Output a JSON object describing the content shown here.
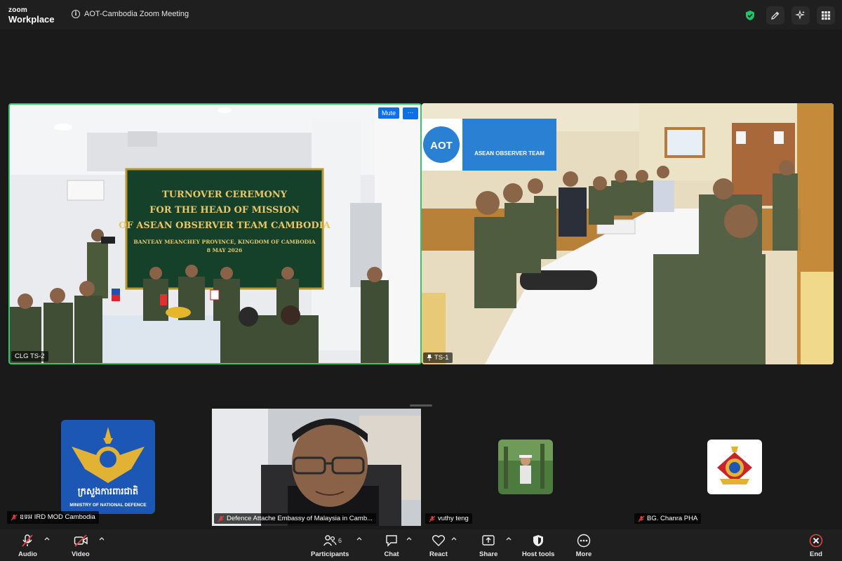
{
  "app": {
    "brand_top": "zoom",
    "brand_bottom": "Workplace",
    "meeting_title": "AOT-Cambodia Zoom Meeting",
    "accent": "#0e6fe8",
    "active_speaker_border": "#35c46b"
  },
  "top_actions": [
    {
      "icon": "shield-check-icon"
    },
    {
      "icon": "pencil-icon"
    },
    {
      "icon": "sparkle-icon"
    },
    {
      "icon": "grid-icon"
    }
  ],
  "videos": {
    "left": {
      "name": "CLG TS-2",
      "mute_label": "Mute",
      "more_label": "···",
      "banner_lines": [
        "TURNOVER CEREMONY",
        "FOR THE HEAD OF MISSION",
        "OF ASEAN OBSERVER TEAM CAMBODIA"
      ],
      "banner_sub": [
        "BANTEAY MEANCHEY PROVINCE, KINGDOM OF CAMBODIA",
        "8 MAY 2026"
      ]
    },
    "right": {
      "name": "TS-1",
      "banner_logo": "AOT",
      "banner_text": "ASEAN OBSERVER TEAM"
    }
  },
  "participants": [
    {
      "name": "ឧទអ IRD MOD Cambodia",
      "muted": true,
      "logo_text": "ក្រសួងការពារជាតិ",
      "logo_sub": "MINISTRY OF NATIONAL DEFENCE"
    },
    {
      "name": "Defence Attache Embassy of Malaysia in Camb...",
      "muted": true
    },
    {
      "name": "vuthy teng",
      "muted": true
    },
    {
      "name": "BG. Chanra PHA",
      "muted": true
    }
  ],
  "toolbar": {
    "audio": "Audio",
    "video": "Video",
    "participants": "Participants",
    "participants_count": "6",
    "chat": "Chat",
    "react": "React",
    "share": "Share",
    "host_tools": "Host tools",
    "more": "More",
    "end": "End"
  }
}
